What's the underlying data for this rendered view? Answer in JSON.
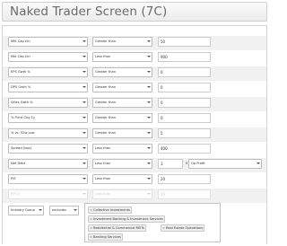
{
  "title": "Naked Trader Screen (7C)",
  "rows": [
    {
      "field": "Mkt Cap £m",
      "operator": "Greater than",
      "value": "50"
    },
    {
      "field": "Mkt Cap £m",
      "operator": "Less than",
      "value": "900"
    },
    {
      "field": "EPS Gwth %",
      "operator": "Greater than",
      "value": "0"
    },
    {
      "field": "DPS Gwth %",
      "operator": "Greater than",
      "value": "0"
    },
    {
      "field": "Sales Gwth %",
      "operator": "Greater than",
      "value": "0"
    },
    {
      "field": "% Price Chg 1y",
      "operator": "Greater than",
      "value": "0"
    },
    {
      "field": "% vs. 52w Low",
      "operator": "Greater than",
      "value": "5"
    },
    {
      "field": "Spread (bps)",
      "operator": "Less than",
      "value": "400"
    }
  ],
  "net_debt": {
    "field": "Net Debt",
    "operator": "Less than",
    "value": "3",
    "multiplier": "x",
    "compare_field": "Op Profit"
  },
  "pe_row": {
    "field": "P/E",
    "operator": "Less than",
    "value": "20"
  },
  "disabled_row": {
    "field": "P/FCF",
    "operator": "Less than",
    "value": "15"
  },
  "industry": {
    "field": "Industry Group",
    "operator": "excludes",
    "remove_glyph": "×",
    "tags": [
      "Collective Investments",
      "Investment Banking & Investment Services",
      "Residential & Commercial REITs",
      "Real Estate Operations",
      "Banking Services"
    ]
  }
}
